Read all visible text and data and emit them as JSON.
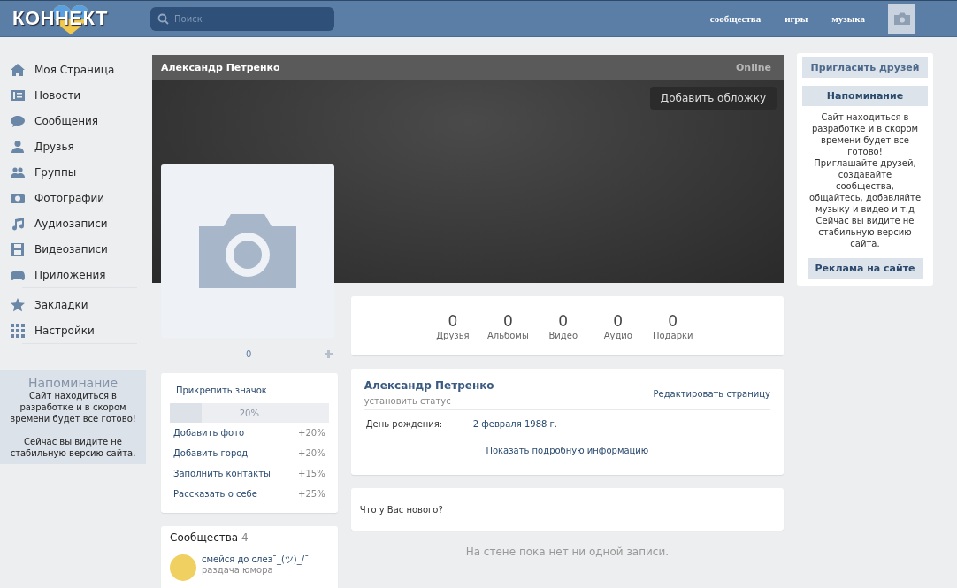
{
  "header": {
    "logo": "КОННЕКТ",
    "search": {
      "placeholder": "Поиск"
    },
    "links": [
      "сообщества",
      "игры",
      "музыка"
    ]
  },
  "sidebar": {
    "items": [
      {
        "label": "Моя Страница",
        "kind": "home"
      },
      {
        "label": "Новости",
        "kind": "news"
      },
      {
        "label": "Сообщения",
        "kind": "messages"
      },
      {
        "label": "Друзья",
        "kind": "friend"
      },
      {
        "label": "Группы",
        "kind": "group"
      },
      {
        "label": "Фотографии",
        "kind": "photo"
      },
      {
        "label": "Аудиозаписи",
        "kind": "music"
      },
      {
        "label": "Видеозаписи",
        "kind": "video"
      },
      {
        "label": "Приложения",
        "kind": "games"
      }
    ],
    "extra_items": [
      {
        "label": "Закладки",
        "kind": "star"
      },
      {
        "label": "Настройки",
        "kind": "grid"
      }
    ],
    "reminder": {
      "title": "Напоминание",
      "text": "Сайт находиться в разработке и в скором времени будет все готово!",
      "note": "Сейчас вы видите не стабильную версию сайта."
    }
  },
  "profile": {
    "name": "Александр Петренко",
    "presence": "Online",
    "cover_button": "Добавить обложку",
    "avatar_count": "0",
    "completion": {
      "title": "Прикрепить значок",
      "level": 0.2,
      "reading": "20%",
      "tasks": [
        {
          "label": "Добавить фото",
          "bonus": "+20%"
        },
        {
          "label": "Добавить город",
          "bonus": "+20%"
        },
        {
          "label": "Заполнить контакты",
          "bonus": "+15%"
        },
        {
          "label": "Рассказать о себе",
          "bonus": "+25%"
        }
      ]
    },
    "communities": {
      "title": "Сообщества",
      "count": "4",
      "items": [
        {
          "name": "смейся до слез¯_(ツ)_/¯",
          "subtitle": "раздача юмора"
        }
      ]
    }
  },
  "stats": [
    {
      "value": "0",
      "label": "Друзья"
    },
    {
      "value": "0",
      "label": "Альбомы"
    },
    {
      "value": "0",
      "label": "Видео"
    },
    {
      "value": "0",
      "label": "Аудио"
    },
    {
      "value": "0",
      "label": "Подарки"
    }
  ],
  "info": {
    "name": "Александр Петренко",
    "status": "установить статус",
    "edit": "Редактировать страницу",
    "fields": [
      {
        "label": "День рождения:",
        "value": "2 февраля 1988 г."
      }
    ],
    "more": "Показать подробную информацию"
  },
  "wall": {
    "placeholder": "Что у Вас нового?",
    "empty": "На стене пока нет ни одной записи."
  },
  "right": {
    "invite": "Пригласить друзей",
    "reminder_title": "Напоминание",
    "reminder_lines": [
      "Сайт находиться в разработке и в скором времени будет все готово!",
      "Приглашайте друзей, создавайте сообщества, общайтесь, добавляйте музыку и видео и т.д",
      "Сейчас вы видите не стабильную версию сайта."
    ],
    "ads": "Реклама на сайте"
  }
}
